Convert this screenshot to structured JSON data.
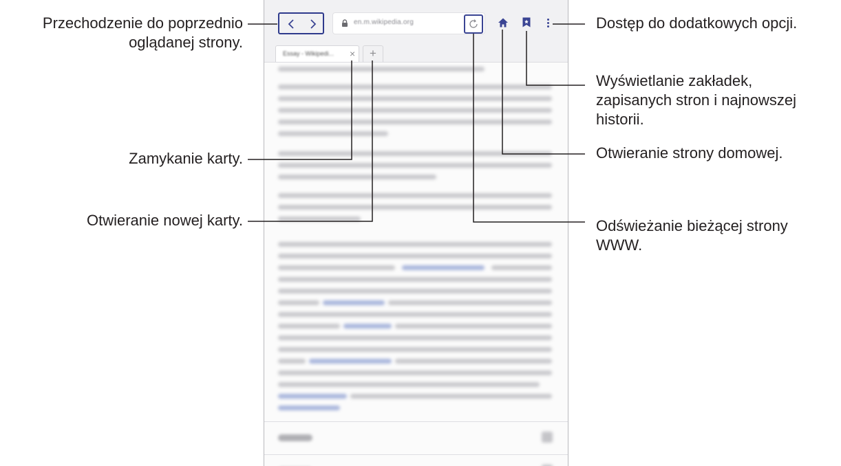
{
  "browser": {
    "url": "en.m.wikipedia.org",
    "tab_title": "Essay - Wikipedi...",
    "tab_close_glyph": "×",
    "new_tab_glyph": "+",
    "icons": [
      "chevron-left-icon",
      "chevron-right-icon",
      "lock-icon",
      "reload-icon",
      "home-icon",
      "bookmark-icon",
      "more-options-icon"
    ],
    "colors": {
      "accent": "#2e3a8c",
      "toolbar": "#f1f1f3"
    }
  },
  "callouts": {
    "back_forward": [
      "Przechodzenie do poprzednio",
      "oglądanej strony."
    ],
    "close_tab": "Zamykanie karty.",
    "new_tab": "Otwieranie nowej karty.",
    "more_options": "Dostęp do dodatkowych opcji.",
    "bookmarks": [
      "Wyświetlanie zakładek,",
      "zapisanych stron i najnowszej",
      "historii."
    ],
    "home": "Otwieranie strony domowej.",
    "refresh": [
      "Odświeżanie bieżącej strony",
      "WWW."
    ]
  }
}
